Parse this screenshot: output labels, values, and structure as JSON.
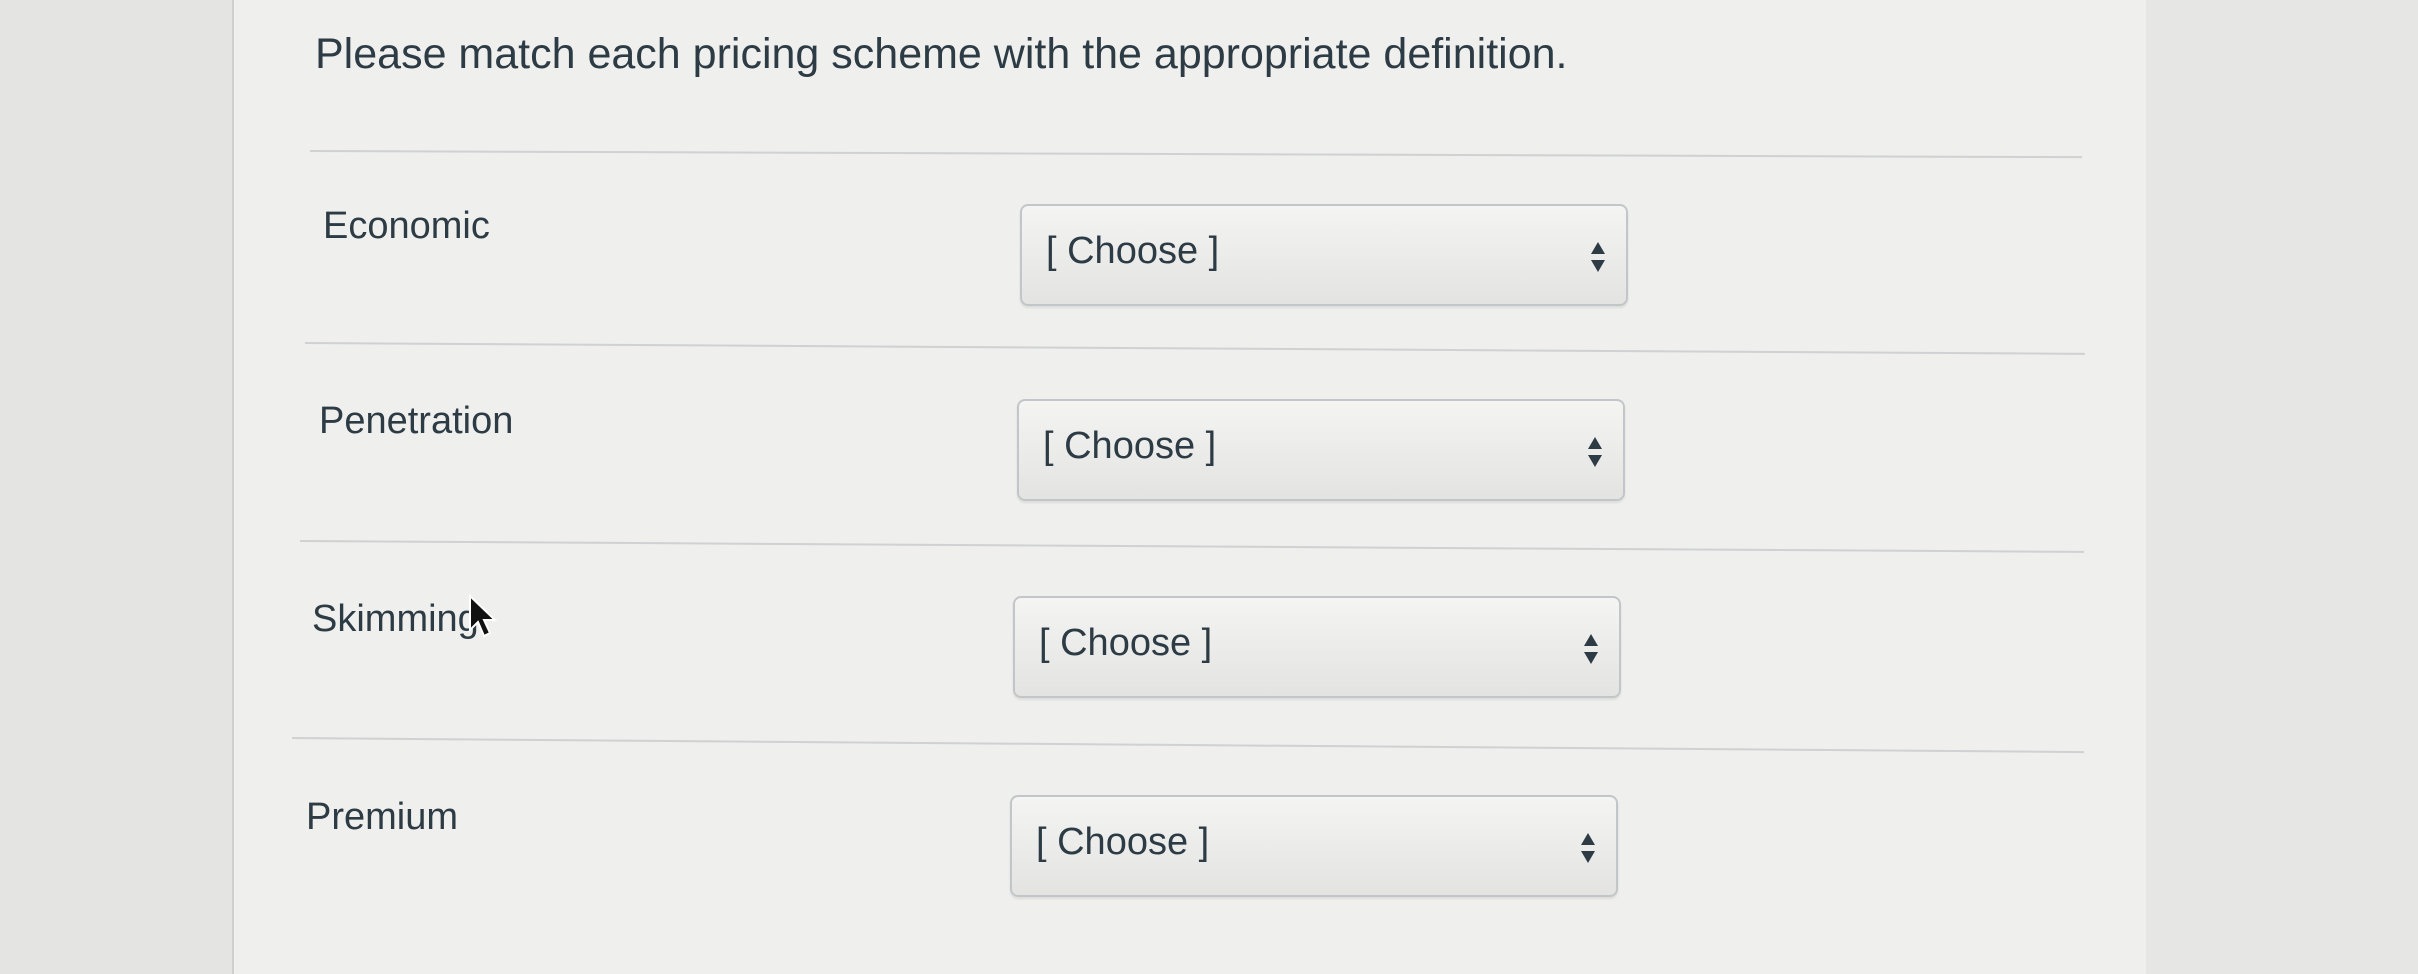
{
  "question": {
    "text": "Please match each pricing scheme with the appropriate definition."
  },
  "rows": [
    {
      "label": "Economic",
      "select": {
        "value": "[ Choose ]",
        "icon": "updown-arrows-icon"
      }
    },
    {
      "label": "Penetration",
      "select": {
        "value": "[ Choose ]",
        "icon": "updown-arrows-icon"
      }
    },
    {
      "label": "Skimming",
      "select": {
        "value": "[ Choose ]",
        "icon": "updown-arrows-icon"
      }
    },
    {
      "label": "Premium",
      "select": {
        "value": "[ Choose ]",
        "icon": "updown-arrows-icon"
      }
    }
  ],
  "colors": {
    "text": "#2d3b45",
    "panel": "#efefed",
    "divider": "#cfd1d2",
    "select_border": "#c3c6c8"
  }
}
